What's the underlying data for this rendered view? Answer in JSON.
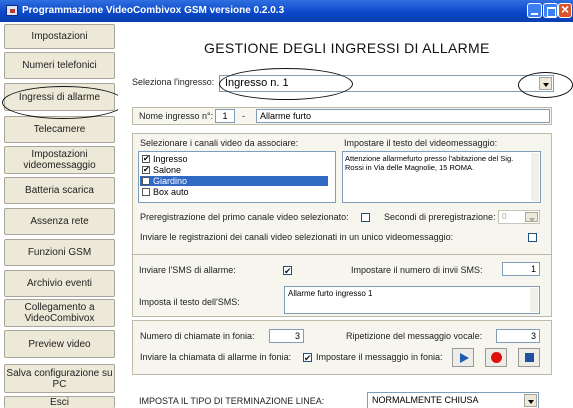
{
  "window": {
    "title": "Programmazione VideoCombivox GSM versione 0.2.0.3"
  },
  "sidebar": {
    "items": [
      {
        "label": "Impostazioni"
      },
      {
        "label": "Numeri telefonici"
      },
      {
        "label": "Ingressi di allarme"
      },
      {
        "label": "Telecamere"
      },
      {
        "label": "Impostazioni videomessaggio"
      },
      {
        "label": "Batteria scarica"
      },
      {
        "label": "Assenza rete"
      },
      {
        "label": "Funzioni GSM"
      },
      {
        "label": "Archivio eventi"
      },
      {
        "label": "Collegamento a VideoCombivox"
      },
      {
        "label": "Preview video"
      },
      {
        "label": "Salva configurazione su PC"
      },
      {
        "label": "Esci"
      }
    ]
  },
  "main": {
    "heading": "GESTIONE DEGLI INGRESSI DI ALLARME",
    "select_input": {
      "label": "Seleziona l'ingresso:",
      "value": "Ingresso n. 1"
    },
    "input_name": {
      "label": "Nome ingresso n°:",
      "number": "1",
      "separator": "-",
      "value": "Allarme furto"
    },
    "channels": {
      "label": "Selezionare i canali video da associare:",
      "items": [
        {
          "label": "Ingresso",
          "checked": "✔"
        },
        {
          "label": "Salone",
          "checked": "✔"
        },
        {
          "label": "Giardino",
          "checked": "✔"
        },
        {
          "label": "Box auto",
          "checked": ""
        }
      ]
    },
    "video_message": {
      "label": "Impostare il testo del videomessaggio:",
      "text": "Attenzione allarmefurto presso l'abitazione del Sig. Rossi in Via delle Magnolie, 15 ROMA."
    },
    "prerecording": {
      "label": "Preregistrazione del primo canale video selezionato:",
      "seconds_label": "Secondi di preregistrazione:",
      "seconds_value": "0"
    },
    "single_message": {
      "label": "Inviare le registrazioni dei canali video selezionati in un unico videomessaggio:"
    },
    "sms": {
      "send_label": "Inviare l'SMS di allarme:",
      "send_checked": "✔",
      "count_label": "Impostare il numero di invii SMS:",
      "count_value": "1",
      "text_label": "Imposta il testo dell'SMS:",
      "text_value": "Allarme furto ingresso 1"
    },
    "voice": {
      "calls_label": "Numero di chiamate in fonia:",
      "calls_value": "3",
      "repeat_label": "Ripetizione del messaggio vocale:",
      "repeat_value": "3",
      "send_label": "Inviare la chiamata di allarme in fonia:",
      "send_checked": "✔",
      "set_message_label": "Impostare il messaggio in fonia:"
    },
    "line": {
      "label": "IMPOSTA IL TIPO DI TERMINAZIONE LINEA:",
      "value": "NORMALMENTE CHIUSA"
    }
  },
  "colors": {
    "titlebar": "#0a46c7",
    "selection": "#316ac5",
    "play": "#1f5bb0",
    "record": "#e01010",
    "stop": "#1f4fa0"
  }
}
